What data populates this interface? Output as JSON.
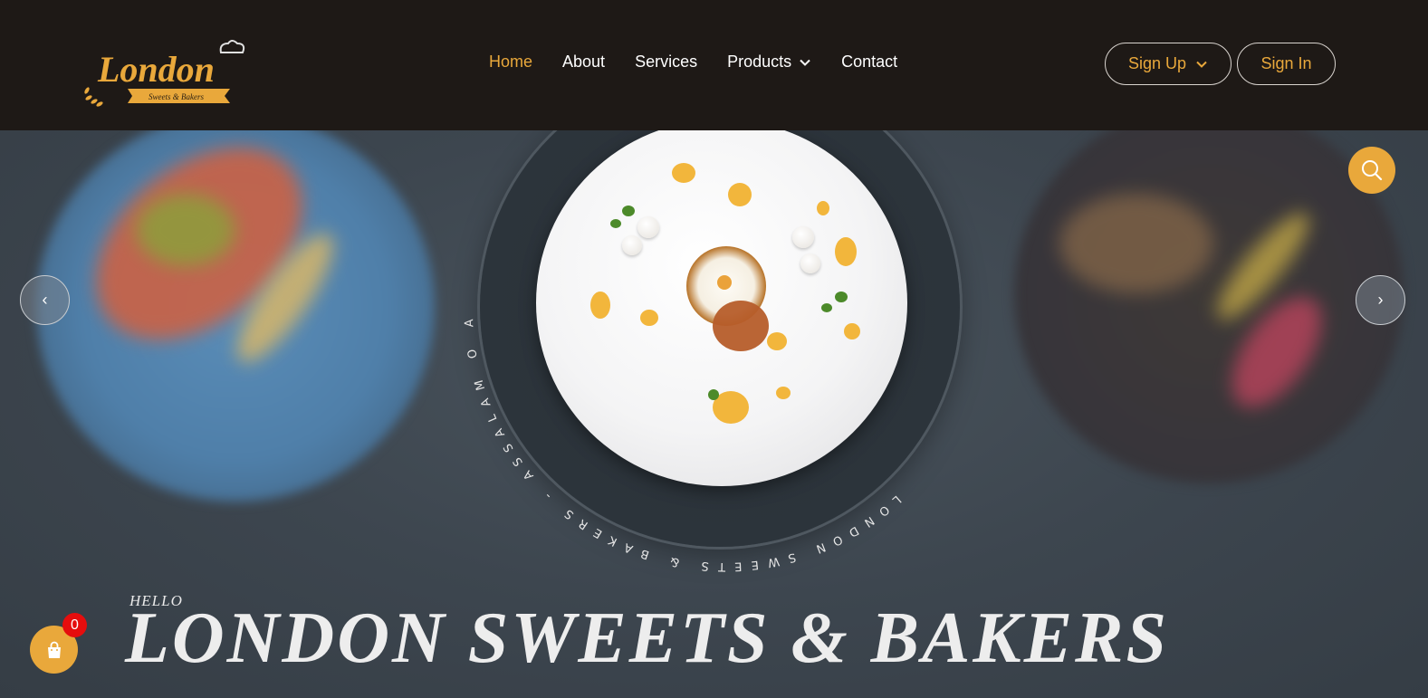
{
  "header": {
    "logo": {
      "text": "London",
      "tagline": "Sweets & Bakers"
    },
    "nav": [
      {
        "label": "Home",
        "active": true
      },
      {
        "label": "About",
        "active": false
      },
      {
        "label": "Services",
        "active": false
      },
      {
        "label": "Products",
        "active": false,
        "dropdown": true
      },
      {
        "label": "Contact",
        "active": false
      }
    ],
    "signup_label": "Sign Up",
    "signin_label": "Sign In"
  },
  "hero": {
    "circular_text": "LONDON SWEETS & BAKERS - ASSALAM O ALIKUM - KONSI MEETHAI CHAHIYE - ",
    "hello": "HELLO",
    "title": "LONDON SWEETS & BAKERS",
    "prev_arrow": "‹",
    "next_arrow": "›"
  },
  "cart": {
    "count": "0",
    "icon": "shopping-bag-icon"
  },
  "search": {
    "icon": "search-icon"
  },
  "colors": {
    "accent": "#e9a83b",
    "header_bg": "#1e1916",
    "badge": "#e50d0d"
  }
}
